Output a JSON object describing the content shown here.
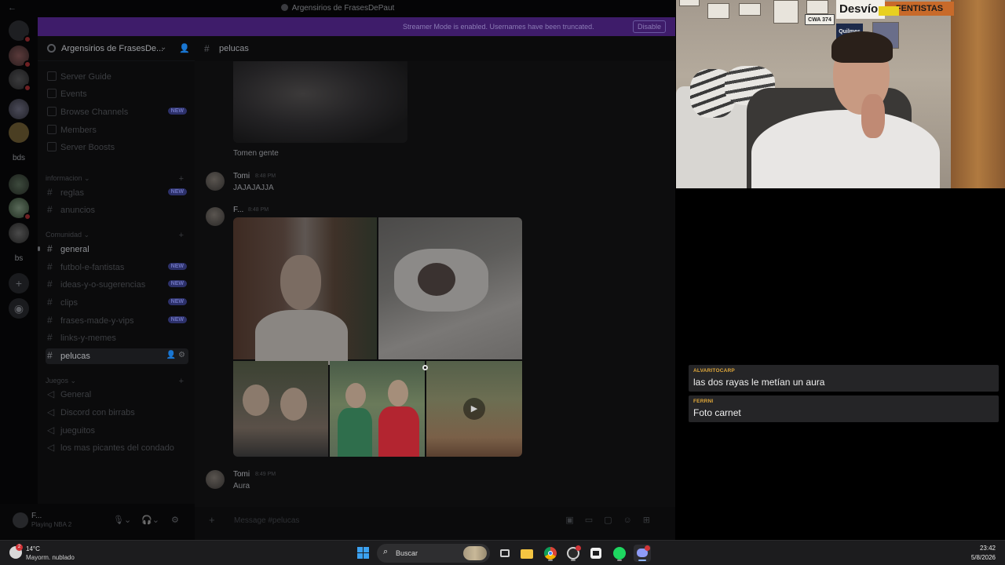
{
  "window": {
    "title": "Argensirios de FrasesDePaut",
    "streamer_banner": "Streamer Mode is enabled. Usernames have been truncated.",
    "disable_label": "Disable"
  },
  "guilds": {
    "labels": [
      "bds",
      "bs"
    ]
  },
  "server": {
    "name": "Argensirios de FrasesDe...",
    "chevron": "⌄",
    "top_items": [
      {
        "label": "Server Guide",
        "badge": ""
      },
      {
        "label": "Events",
        "badge": ""
      },
      {
        "label": "Browse Channels",
        "badge": "NEW"
      },
      {
        "label": "Members",
        "badge": ""
      },
      {
        "label": "Server Boosts",
        "badge": ""
      }
    ],
    "categories": [
      {
        "name": "informacion",
        "channels": [
          {
            "label": "reglas",
            "badge": "NEW",
            "bright": false
          },
          {
            "label": "anuncios",
            "badge": "",
            "bright": false
          }
        ]
      },
      {
        "name": "Comunidad",
        "channels": [
          {
            "label": "general",
            "badge": "",
            "bright": true
          },
          {
            "label": "futbol-e-fantistas",
            "badge": "NEW",
            "bright": false
          },
          {
            "label": "ideas-y-o-sugerencias",
            "badge": "NEW",
            "bright": false
          },
          {
            "label": "clips",
            "badge": "NEW",
            "bright": false
          },
          {
            "label": "frases-made-y-vips",
            "badge": "NEW",
            "bright": false
          },
          {
            "label": "links-y-memes",
            "badge": "",
            "bright": false
          },
          {
            "label": "pelucas",
            "badge": "",
            "bright": true,
            "selected": true
          }
        ]
      },
      {
        "name": "Juegos",
        "channels": [
          {
            "label": "General",
            "badge": "",
            "bright": false
          },
          {
            "label": "Discord con birrabs",
            "badge": "",
            "bright": false
          },
          {
            "label": "jueguitos",
            "badge": "",
            "bright": false
          },
          {
            "label": "los mas picantes del condado",
            "badge": "",
            "bright": false
          }
        ]
      }
    ]
  },
  "user": {
    "name": "F...",
    "status": "Playing NBA 2"
  },
  "channel": {
    "name": "pelucas"
  },
  "messages": [
    {
      "type": "text",
      "text": "Tomen gente"
    },
    {
      "type": "message",
      "author": "Tomi",
      "time": "8:48 PM",
      "text": "JAJAJAJJA"
    },
    {
      "type": "message",
      "author": "F...",
      "time": "8:48 PM",
      "text": ""
    },
    {
      "type": "message",
      "author": "Tomi",
      "time": "8:49 PM",
      "text": "Aura"
    }
  ],
  "composer": {
    "placeholder": "Message #pelucas"
  },
  "stream_chat": [
    {
      "user": "ALVARITOCARP",
      "text": "las dos rayas le metían un aura"
    },
    {
      "user": "FERRNI",
      "text": "Foto carnet"
    }
  ],
  "webcam": {
    "sign_desvio": "Desvío",
    "sign_fenti": "FENTISTAS",
    "plate": "CWA 374",
    "quilmes": "Quilmes"
  },
  "taskbar": {
    "temperature": "14°C",
    "weather": "Mayorm. nublado",
    "weather_badge": "2",
    "search_label": "Buscar",
    "time": "23:42",
    "date": "5/8/2026"
  },
  "colors": {
    "streamer_banner": "#3e1c6a",
    "new_badge": "#2c3069",
    "chat_username": "#e0a83a"
  }
}
